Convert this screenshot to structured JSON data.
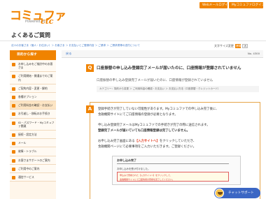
{
  "header": {
    "logo_main": "コミュファ",
    "logo_sub": "Powered by",
    "logo_ctc": "ctc",
    "buttons": [
      "Webメールログイン",
      "Myコミュファログイン"
    ]
  },
  "page_title": "よくあるご質問",
  "breadcrumb": "法人のお客さま（個人・お住まい）＞ お客さま ＞ お支払いとご登録内容 ＞ ご請求 ＞ ご請求書等の送付について",
  "font_size": {
    "label": "文字サイズ変更",
    "options": [
      "標準",
      "大"
    ]
  },
  "sidebar": {
    "heading": "目的から探す",
    "items": [
      "お申し込みをご検討中のお客さま",
      "ご利用開始・開通までのご案内",
      "ご契約内容・変更・解約",
      "各種オプション",
      "ご利用料金の確認・お支払い",
      "お引越し・移転のお手続き",
      "ID・パスワード・Myコミュファ関連",
      "接続・設定方法",
      "メール",
      "故障・トラブル",
      "お客さまサポートのご案内",
      "ご利用中のご案内",
      "通信サービス"
    ]
  },
  "main": {
    "back_label": "戻る",
    "qno": "No. 4300",
    "q_badge": "Q",
    "question": "口座振替の申し込み登録完了メールが届いたのに、口座情報が登録されていません",
    "question_sub": "口座振替の申し込み登録完了メールが届いたのに、口座情報が登録されていません",
    "category": "カテゴリー：契約から変更 ＞ ご利用料金の確認・お支払い ＞ お支払い方法（口座振替・クレジットカード）",
    "a_badge": "A",
    "answer_lines": [
      "登録手続きが完了していない可能性があります。Myコミュファでの申し込み完了後に、",
      "金融機関サイトにてご口座情報の登録が必要となります。",
      "申し込み登録完了メールはMyコミュファでの手続きが完了の際に送信されます。",
      "登録完了メールが届いていても口座情報登録は完了していません。",
      "お申し込み完了画面にある",
      "【入力サイトへ】",
      "をクリックしていただき、",
      "金融機関ページにて必要事項をご入力いただきます。ご登録ください。"
    ],
    "mock": {
      "title": "お申し込み完了",
      "sub": "お申し込みを受け付けました。",
      "alert_lines": [
        "申込みで登録された【入力サイトへ】をクリックして、",
        "金融機関サイトにて口座情報の登録を完了してください。"
      ]
    }
  },
  "chat": {
    "label": "チャットサポート"
  },
  "colors": {
    "brand": "#f08300",
    "link": "#3973c6",
    "chat": "#3b66c4"
  }
}
